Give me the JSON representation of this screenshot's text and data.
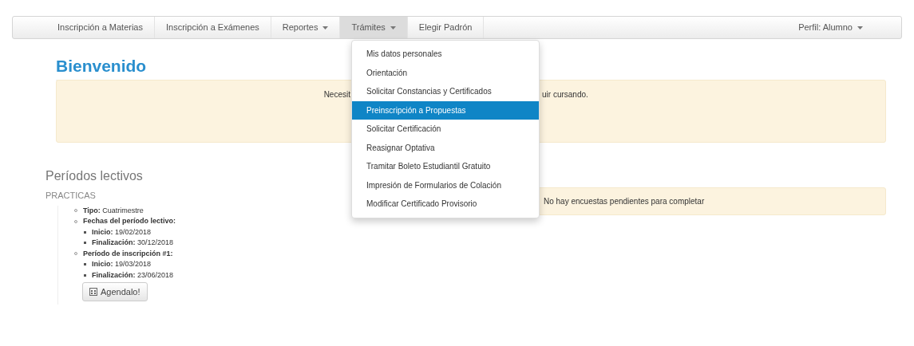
{
  "navbar": {
    "items": [
      {
        "label": "Inscripción a Materias",
        "dropdown": false,
        "selected": false
      },
      {
        "label": "Inscripción a Exámenes",
        "dropdown": false,
        "selected": false
      },
      {
        "label": "Reportes",
        "dropdown": true,
        "selected": false
      },
      {
        "label": "Trámites",
        "dropdown": true,
        "selected": true
      },
      {
        "label": "Elegir Padrón",
        "dropdown": false,
        "selected": false
      }
    ],
    "profile": {
      "label": "Perfil: Alumno",
      "dropdown": true
    }
  },
  "dropdown_menu": [
    {
      "label": "Mis datos personales",
      "selected": false
    },
    {
      "label": "Orientación",
      "selected": false
    },
    {
      "label": "Solicitar Constancias y Certificados",
      "selected": false
    },
    {
      "label": "Preinscripción a Propuestas",
      "selected": true
    },
    {
      "label": "Solicitar Certificación",
      "selected": false
    },
    {
      "label": "Reasignar Optativa",
      "selected": false
    },
    {
      "label": "Tramitar Boleto Estudiantil Gratuito",
      "selected": false
    },
    {
      "label": "Impresión de Formularios de Colación",
      "selected": false
    },
    {
      "label": "Modificar Certificado Provisorio",
      "selected": false
    }
  ],
  "title": "Bienvenido",
  "alert": {
    "text_left": "Necesit",
    "text_right": "uir cursando."
  },
  "periods": {
    "title": "Períodos lectivos",
    "subtitle": "PRACTICAS",
    "items": [
      {
        "label": "Tipo:",
        "value": "Cuatrimestre"
      },
      {
        "label": "Fechas del período lectivo:",
        "value": "",
        "children": [
          {
            "label": "Inicio:",
            "value": "19/02/2018"
          },
          {
            "label": "Finalización:",
            "value": "30/12/2018"
          }
        ]
      },
      {
        "label": "Período de inscripción #1:",
        "value": "",
        "children": [
          {
            "label": "Inicio:",
            "value": "19/03/2018"
          },
          {
            "label": "Finalización:",
            "value": "23/06/2018"
          }
        ]
      }
    ],
    "button": "Agendalo!"
  },
  "surveys": {
    "message": "No hay encuestas pendientes para completar"
  }
}
